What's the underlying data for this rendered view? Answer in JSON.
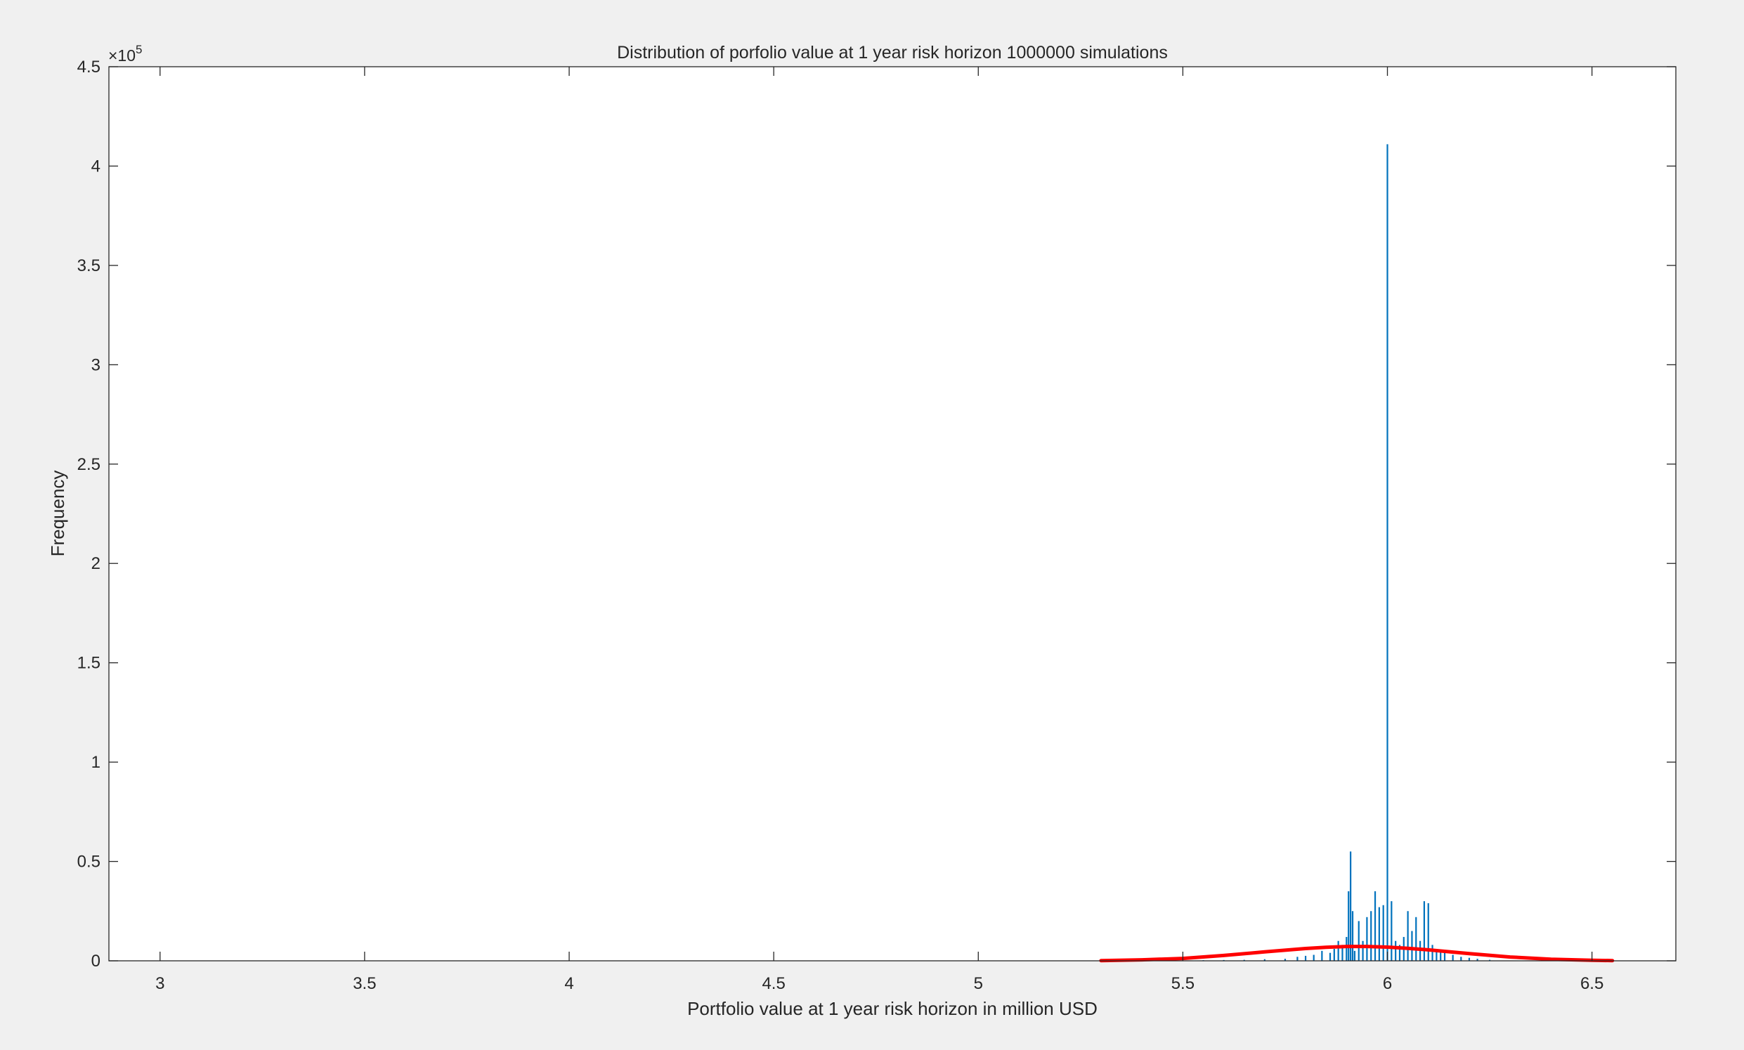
{
  "chart_data": {
    "type": "bar",
    "title": "Distribution of porfolio value at 1 year risk horizon 1000000 simulations",
    "xlabel": "Portfolio value at 1 year risk horizon in million USD",
    "ylabel": "Frequency",
    "y_exponent_label": "×10",
    "y_exponent_power": "5",
    "xlim": [
      2.875,
      6.705
    ],
    "ylim": [
      0,
      4.5
    ],
    "xticks": [
      3,
      3.5,
      4,
      4.5,
      5,
      5.5,
      6,
      6.5
    ],
    "xtick_labels": [
      "3",
      "3.5",
      "4",
      "4.5",
      "5",
      "5.5",
      "6",
      "6.5"
    ],
    "yticks": [
      0,
      0.5,
      1,
      1.5,
      2,
      2.5,
      3,
      3.5,
      4,
      4.5
    ],
    "ytick_labels": [
      "0",
      "0.5",
      "1",
      "1.5",
      "2",
      "2.5",
      "3",
      "3.5",
      "4",
      "4.5"
    ],
    "grid": false,
    "box": true,
    "series": [
      {
        "kind": "histogram",
        "color": "#0072bd",
        "x": [
          5.55,
          5.6,
          5.65,
          5.7,
          5.75,
          5.78,
          5.8,
          5.82,
          5.84,
          5.86,
          5.87,
          5.88,
          5.89,
          5.9,
          5.905,
          5.91,
          5.915,
          5.92,
          5.93,
          5.94,
          5.95,
          5.96,
          5.97,
          5.98,
          5.99,
          6.0,
          6.01,
          6.02,
          6.03,
          6.04,
          6.05,
          6.06,
          6.07,
          6.08,
          6.09,
          6.1,
          6.11,
          6.12,
          6.13,
          6.14,
          6.16,
          6.18,
          6.2,
          6.22,
          6.25
        ],
        "values": [
          0.003,
          0.004,
          0.005,
          0.008,
          0.01,
          0.02,
          0.025,
          0.03,
          0.05,
          0.04,
          0.06,
          0.1,
          0.08,
          0.12,
          0.35,
          0.55,
          0.25,
          0.05,
          0.2,
          0.1,
          0.22,
          0.25,
          0.35,
          0.27,
          0.28,
          4.11,
          0.3,
          0.1,
          0.08,
          0.12,
          0.25,
          0.15,
          0.22,
          0.1,
          0.3,
          0.29,
          0.08,
          0.06,
          0.05,
          0.04,
          0.03,
          0.02,
          0.015,
          0.01,
          0.005
        ]
      },
      {
        "kind": "fit-line",
        "color": "#ff0000",
        "x": [
          5.3,
          5.4,
          5.5,
          5.6,
          5.7,
          5.8,
          5.85,
          5.9,
          5.95,
          6.0,
          6.05,
          6.1,
          6.2,
          6.3,
          6.4,
          6.5,
          6.55
        ],
        "values": [
          0.001,
          0.005,
          0.012,
          0.027,
          0.045,
          0.062,
          0.068,
          0.072,
          0.072,
          0.069,
          0.063,
          0.055,
          0.036,
          0.019,
          0.008,
          0.003,
          0.001
        ]
      }
    ]
  }
}
